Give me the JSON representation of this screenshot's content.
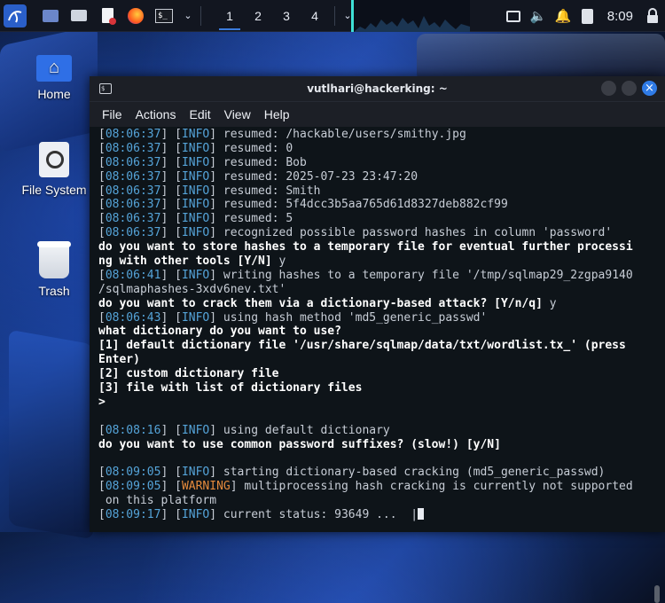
{
  "panel": {
    "workspaces": [
      "1",
      "2",
      "3",
      "4"
    ],
    "active_workspace": 0,
    "clock": "8:09"
  },
  "desktop": {
    "icons": [
      {
        "label": "Home"
      },
      {
        "label": "File System"
      },
      {
        "label": "Trash"
      }
    ]
  },
  "window": {
    "title": "vutlhari@hackerking: ~",
    "menu": [
      "File",
      "Actions",
      "Edit",
      "View",
      "Help"
    ]
  },
  "terminal": {
    "lines": [
      {
        "kind": "log",
        "time": "08:06:37",
        "level": "INFO",
        "text": " resumed: /hackable/users/smithy.jpg"
      },
      {
        "kind": "log",
        "time": "08:06:37",
        "level": "INFO",
        "text": " resumed: 0"
      },
      {
        "kind": "log",
        "time": "08:06:37",
        "level": "INFO",
        "text": " resumed: Bob"
      },
      {
        "kind": "log",
        "time": "08:06:37",
        "level": "INFO",
        "text": " resumed: 2025-07-23 23:47:20"
      },
      {
        "kind": "log",
        "time": "08:06:37",
        "level": "INFO",
        "text": " resumed: Smith"
      },
      {
        "kind": "log",
        "time": "08:06:37",
        "level": "INFO",
        "text": " resumed: 5f4dcc3b5aa765d61d8327deb882cf99"
      },
      {
        "kind": "log",
        "time": "08:06:37",
        "level": "INFO",
        "text": " resumed: 5"
      },
      {
        "kind": "log",
        "time": "08:06:37",
        "level": "INFO",
        "text": " recognized possible password hashes in column 'password'"
      },
      {
        "kind": "q",
        "text": "do you want to store hashes to a temporary file for eventual further processi"
      },
      {
        "kind": "q",
        "text": "ng with other tools [Y/N]",
        "answer": " y"
      },
      {
        "kind": "log",
        "time": "08:06:41",
        "level": "INFO",
        "text": " writing hashes to a temporary file '/tmp/sqlmap29_2zgpa9140"
      },
      {
        "kind": "plain",
        "text": "/sqlmaphashes-3xdv6nev.txt'"
      },
      {
        "kind": "q",
        "text": "do you want to crack them via a dictionary-based attack? [Y/n/q]",
        "answer": " y"
      },
      {
        "kind": "log",
        "time": "08:06:43",
        "level": "INFO",
        "text": " using hash method 'md5_generic_passwd'"
      },
      {
        "kind": "q",
        "text": "what dictionary do you want to use?"
      },
      {
        "kind": "q",
        "text": "[1] default dictionary file '/usr/share/sqlmap/data/txt/wordlist.tx_' (press"
      },
      {
        "kind": "q",
        "text": "Enter)"
      },
      {
        "kind": "q",
        "text": "[2] custom dictionary file"
      },
      {
        "kind": "q",
        "text": "[3] file with list of dictionary files"
      },
      {
        "kind": "q",
        "text": ">"
      },
      {
        "kind": "blank",
        "text": ""
      },
      {
        "kind": "log",
        "time": "08:08:16",
        "level": "INFO",
        "text": " using default dictionary"
      },
      {
        "kind": "q",
        "text": "do you want to use common password suffixes? (slow!) [y/N]"
      },
      {
        "kind": "blank",
        "text": ""
      },
      {
        "kind": "log",
        "time": "08:09:05",
        "level": "INFO",
        "text": " starting dictionary-based cracking (md5_generic_passwd)"
      },
      {
        "kind": "log",
        "time": "08:09:05",
        "level": "WARNING",
        "text": " multiprocessing hash cracking is currently not supported"
      },
      {
        "kind": "plain",
        "text": " on this platform"
      },
      {
        "kind": "log",
        "time": "08:09:17",
        "level": "INFO",
        "text": " current status: 93649 ...  |",
        "cursor": true
      }
    ]
  },
  "colors": {
    "timestamp": "#55a4d9",
    "info": "#55a4d9",
    "warning": "#e58a3c",
    "accent": "#2f7be6"
  }
}
